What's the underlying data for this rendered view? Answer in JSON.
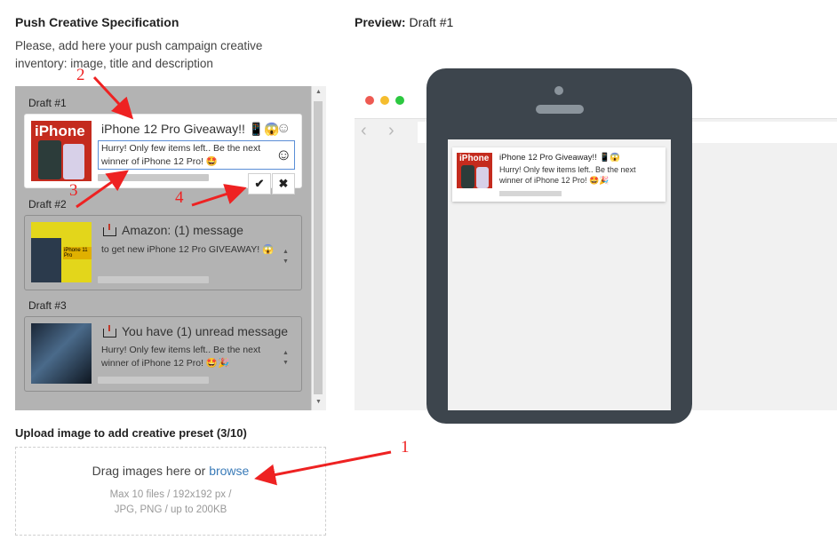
{
  "spec": {
    "title": "Push Creative Specification",
    "description": "Please, add here your push campaign creative inventory: image, title and description"
  },
  "drafts": [
    {
      "label": "Draft #1",
      "title": "iPhone 12 Pro Giveaway!! 📱😱",
      "text": "Hurry! Only few items left.. Be the next winner of iPhone 12 Pro! 🤩",
      "thumb_text": "iPhone",
      "state": "editing"
    },
    {
      "label": "Draft #2",
      "title": "Amazon: (1) message",
      "text": "to get new iPhone 12 Pro GIVEAWAY! 😱",
      "thumb_text": "iPhone 11 Pro"
    },
    {
      "label": "Draft #3",
      "title": "You have (1) unread message",
      "text": "Hurry! Only few items left.. Be the next winner of iPhone 12 Pro! 🤩🎉"
    }
  ],
  "actions": {
    "confirm": "✔",
    "cancel": "✖"
  },
  "upload": {
    "title": "Upload image to add creative preset (3/10)",
    "drag_text": "Drag images here or",
    "browse": "browse",
    "hint_1": "Max 10 files / 192x192 px /",
    "hint_2": "JPG, PNG / up to 200KB"
  },
  "preview": {
    "label": "Preview:",
    "draft": "Draft #1",
    "notification": {
      "title": "iPhone 12 Pro Giveaway!! 📱😱",
      "text": "Hurry! Only few items left.. Be the next winner of iPhone 12 Pro! 🤩🎉",
      "thumb_text": "iPhone"
    }
  },
  "annotations": [
    "1",
    "2",
    "3",
    "4"
  ],
  "icons": {
    "emoji_picker": "smiley-icon",
    "message": "download-icon",
    "scroll": "stepper-arrows-icon",
    "traffic_lights": [
      "#ee5a52",
      "#f5bd2e",
      "#2cc840"
    ]
  }
}
